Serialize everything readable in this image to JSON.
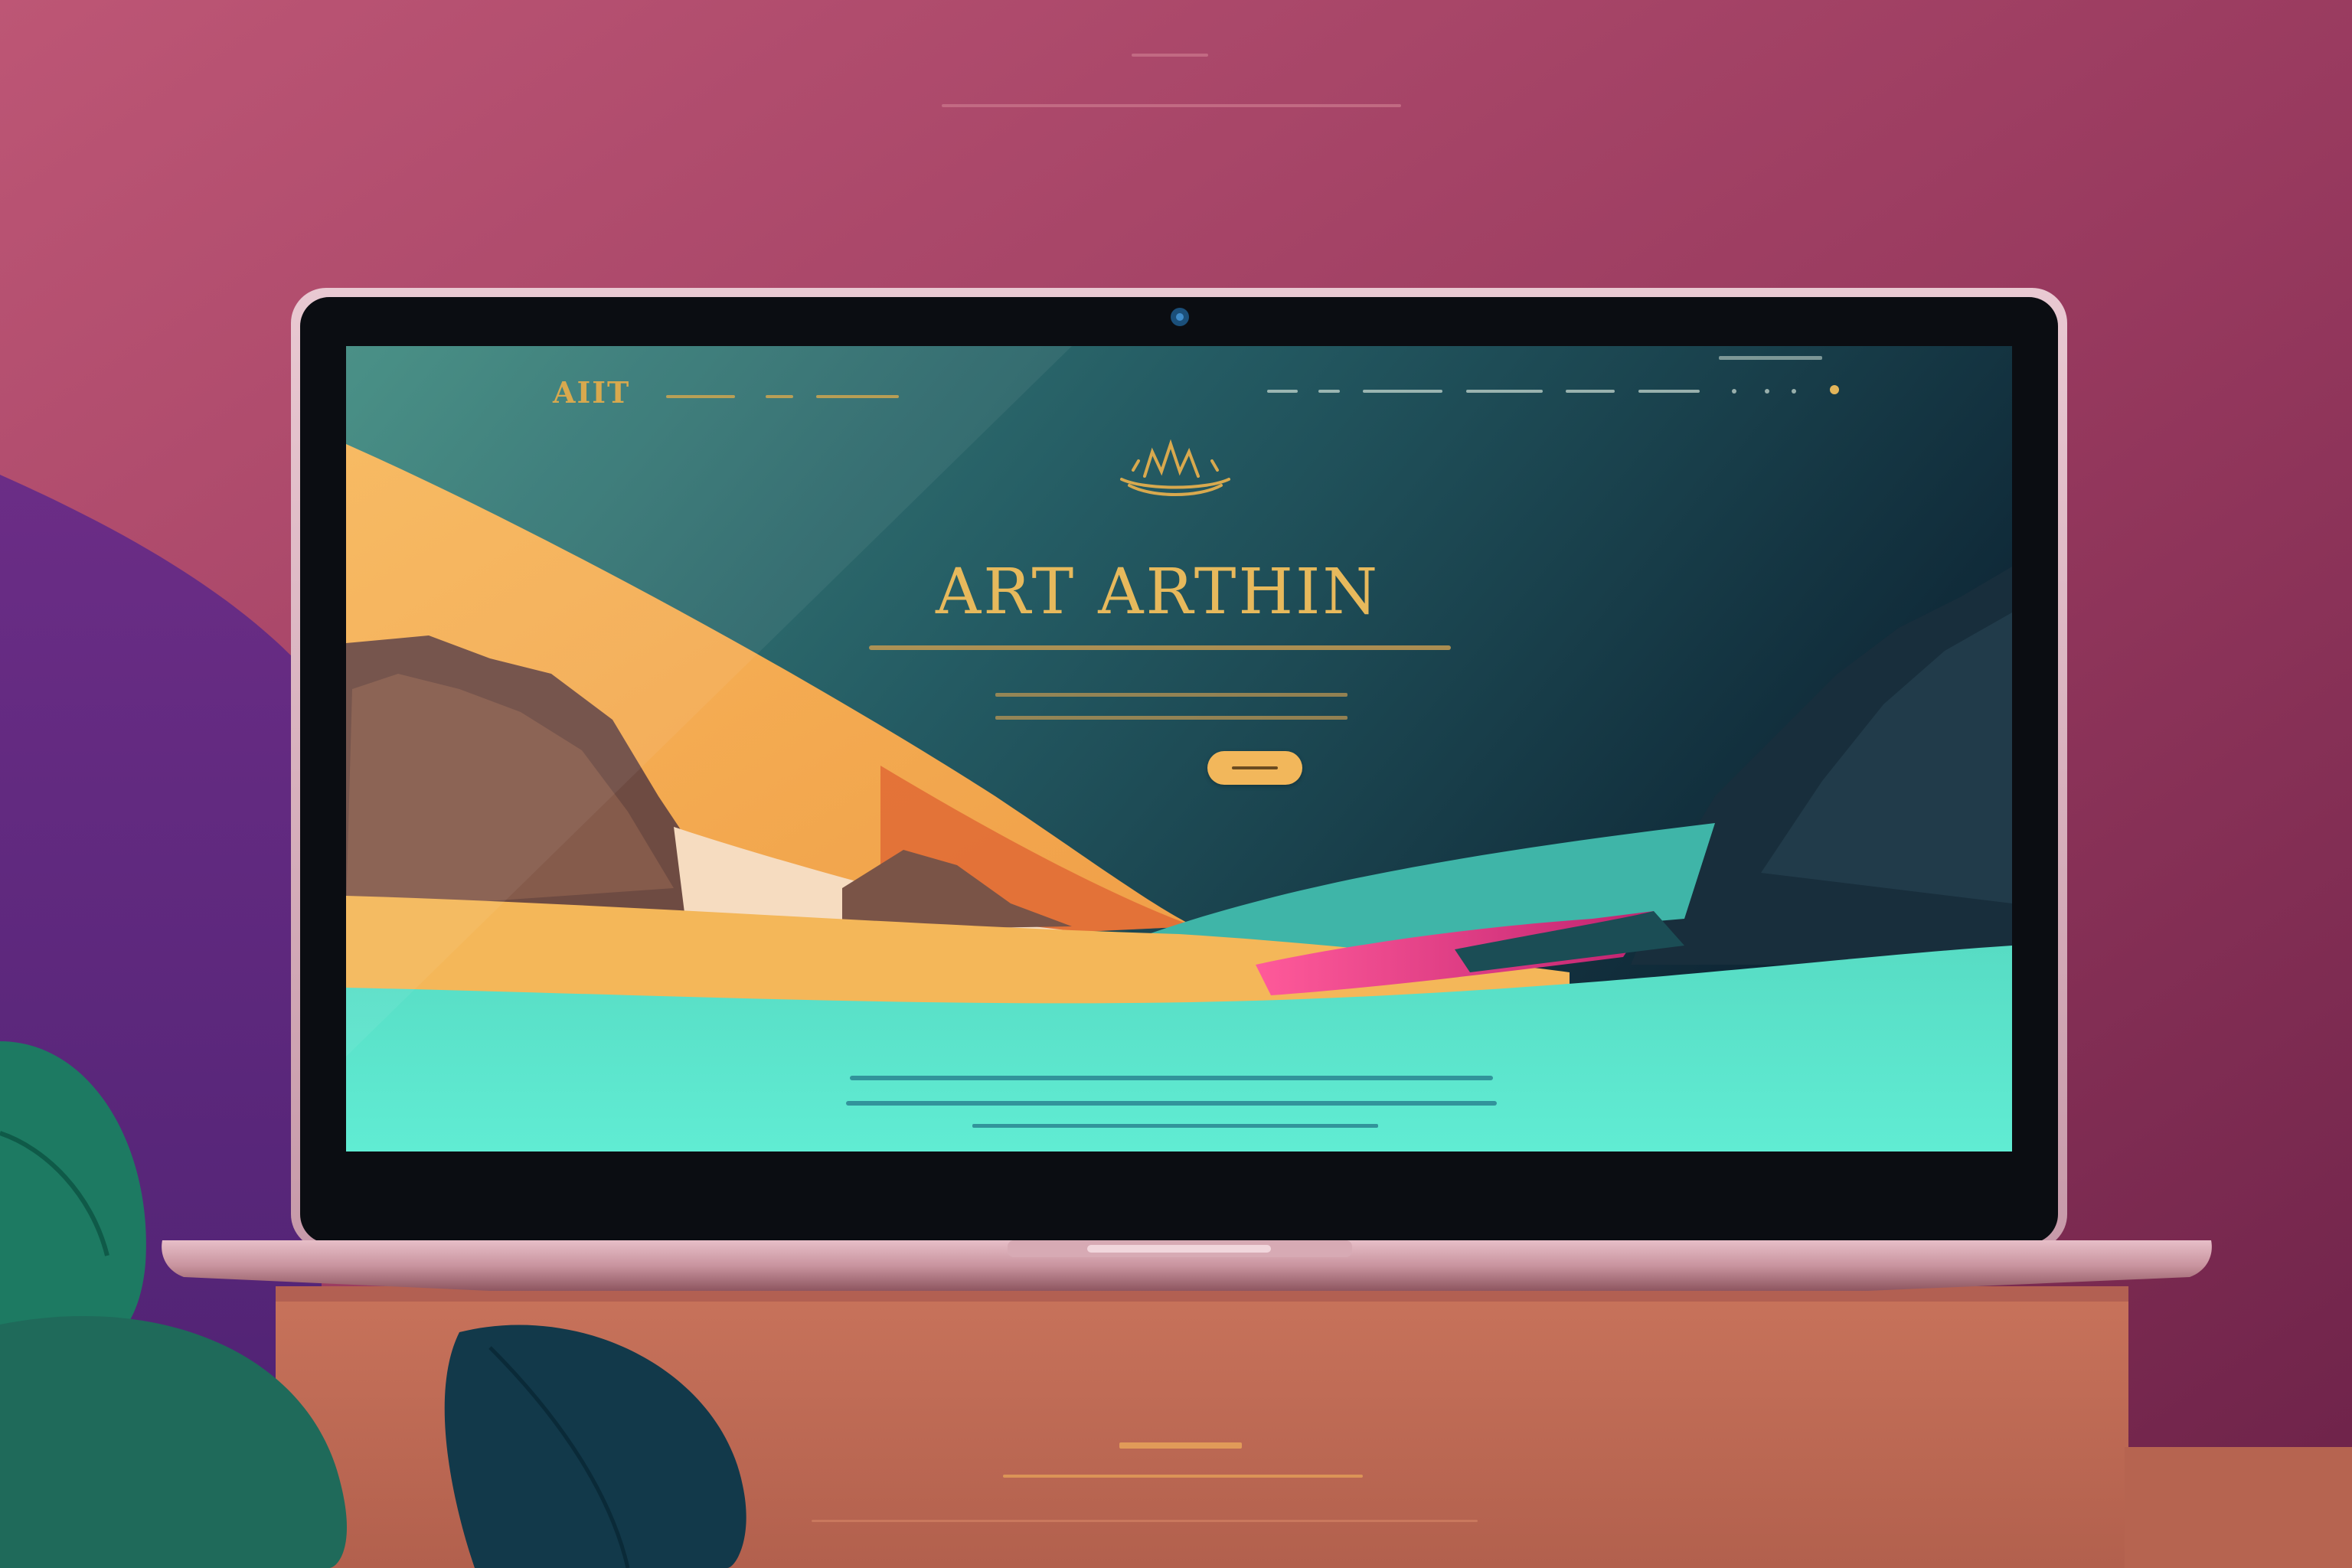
{
  "backdrop": {
    "top_caption_short": "",
    "top_caption_long": "",
    "bottom_heading": "",
    "bottom_caption": ""
  },
  "site": {
    "logo": "AIIT",
    "nav_left": [
      "",
      "",
      ""
    ],
    "nav_right": [
      "",
      "",
      "",
      "",
      "",
      ""
    ],
    "hero_title": "ART ARTHIN",
    "cta_label": ""
  },
  "colors": {
    "bg_pink": "#b9546f",
    "bg_plum": "#7c2a52",
    "screen_teal": "#3c857c",
    "screen_dark": "#0f2a38",
    "accent_gold": "#d8a94e",
    "cta": "#f2b75b",
    "water": "#5de6cd"
  }
}
